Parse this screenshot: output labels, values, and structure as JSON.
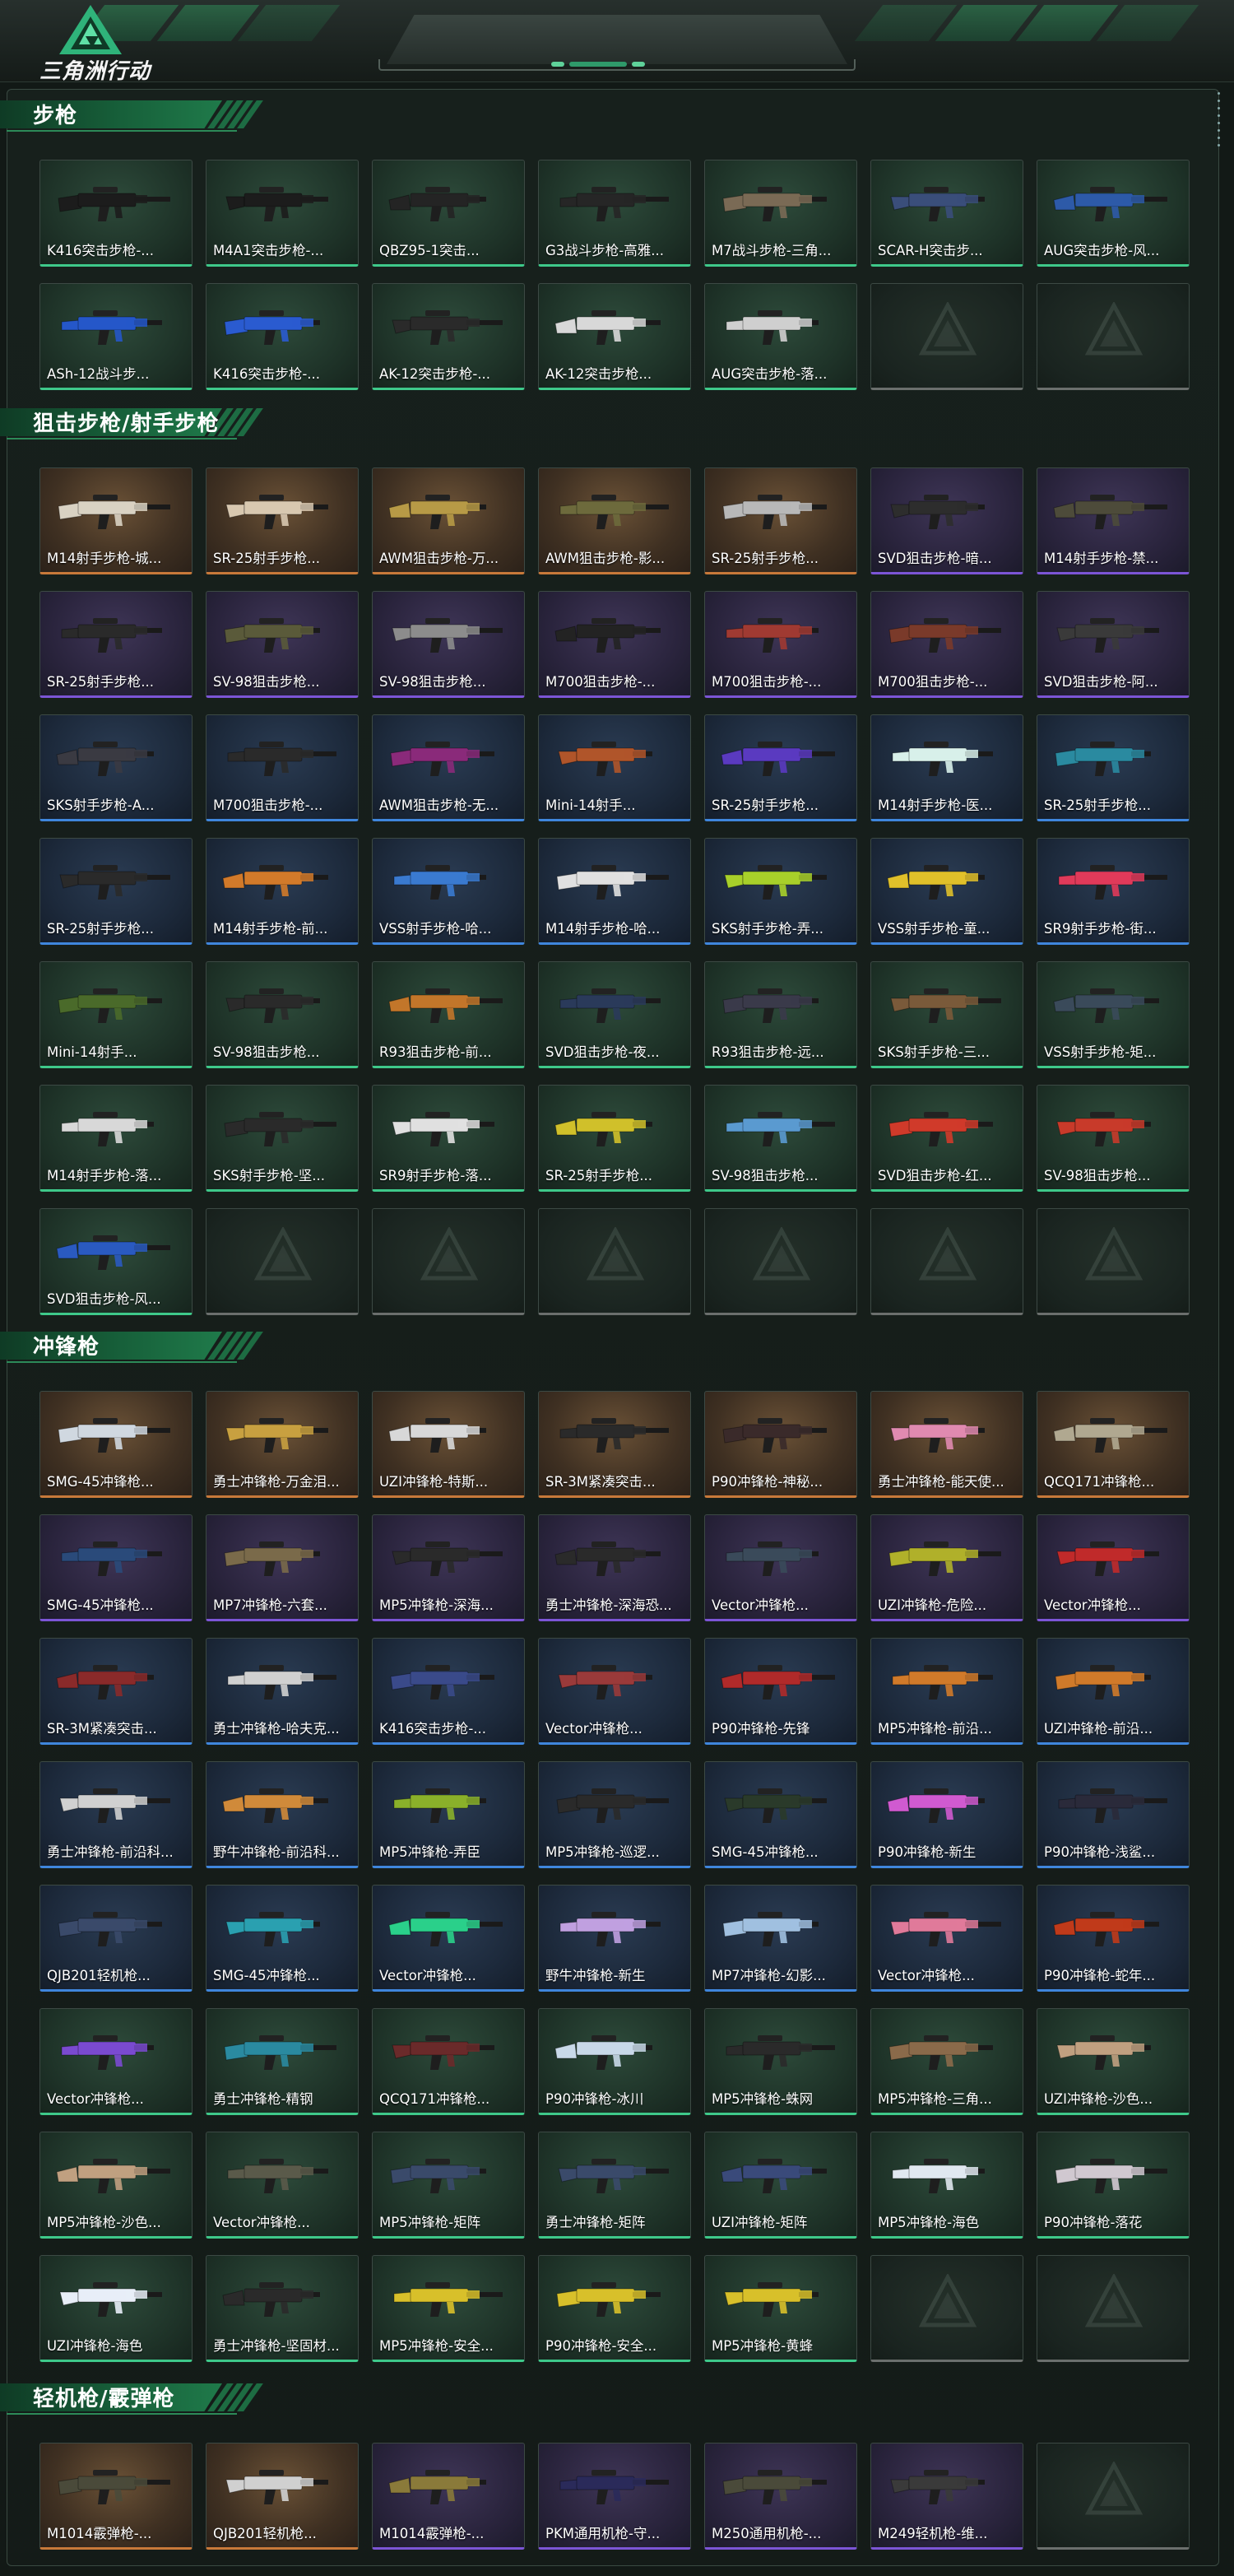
{
  "app": {
    "logo_text": "三角洲行动"
  },
  "colors": {
    "rarity_gold": "#c8793a",
    "rarity_purple": "#7c55d6",
    "rarity_blue": "#3f86dd",
    "rarity_green": "#3ec98a",
    "accent": "#1f7a4a"
  },
  "sections": [
    {
      "title": "步枪",
      "items": [
        {
          "label": "K416突击步枪-...",
          "rarity": "green",
          "color": "#1c1c1c"
        },
        {
          "label": "M4A1突击步枪-...",
          "rarity": "green",
          "color": "#1c1c1c"
        },
        {
          "label": "QBZ95-1突击...",
          "rarity": "green",
          "color": "#242424"
        },
        {
          "label": "G3战斗步枪-高雅...",
          "rarity": "green",
          "color": "#262626"
        },
        {
          "label": "M7战斗步枪-三角...",
          "rarity": "green",
          "color": "#7a6a55"
        },
        {
          "label": "SCAR-H突击步...",
          "rarity": "green",
          "color": "#3a4e7a"
        },
        {
          "label": "AUG突击步枪-风...",
          "rarity": "green",
          "color": "#2d5aa8"
        },
        {
          "label": "ASh-12战斗步...",
          "rarity": "green",
          "color": "#2557c9"
        },
        {
          "label": "K416突击步枪-...",
          "rarity": "green",
          "color": "#2a5bd0"
        },
        {
          "label": "AK-12突击步枪-...",
          "rarity": "green",
          "color": "#2a2a2a"
        },
        {
          "label": "AK-12突击步枪...",
          "rarity": "green",
          "color": "#d8d8d8"
        },
        {
          "label": "AUG突击步枪-落...",
          "rarity": "green",
          "color": "#cfcfcf"
        },
        {
          "label": "",
          "rarity": "empty"
        },
        {
          "label": "",
          "rarity": "empty"
        }
      ]
    },
    {
      "title": "狙击步枪/射手步枪",
      "items": [
        {
          "label": "M14射手步枪-城...",
          "rarity": "gold",
          "color": "#d9d2c3"
        },
        {
          "label": "SR-25射手步枪...",
          "rarity": "gold",
          "color": "#d8c8b0"
        },
        {
          "label": "AWM狙击步枪-万...",
          "rarity": "gold",
          "color": "#b79a46"
        },
        {
          "label": "AWM狙击步枪-影...",
          "rarity": "gold",
          "color": "#6d6a3c"
        },
        {
          "label": "SR-25射手步枪...",
          "rarity": "gold",
          "color": "#b8b8b8"
        },
        {
          "label": "SVD狙击步枪-暗...",
          "rarity": "purple",
          "color": "#2d2d2d"
        },
        {
          "label": "M14射手步枪-禁...",
          "rarity": "purple",
          "color": "#4d4b3a"
        },
        {
          "label": "SR-25射手步枪...",
          "rarity": "purple",
          "color": "#2a2a2a"
        },
        {
          "label": "SV-98狙击步枪...",
          "rarity": "purple",
          "color": "#5a5a3a"
        },
        {
          "label": "SV-98狙击步枪...",
          "rarity": "purple",
          "color": "#8c8c8c"
        },
        {
          "label": "M700狙击步枪-...",
          "rarity": "purple",
          "color": "#232323"
        },
        {
          "label": "M700狙击步枪-...",
          "rarity": "purple",
          "color": "#a03a32"
        },
        {
          "label": "M700狙击步枪-...",
          "rarity": "purple",
          "color": "#7a3a2a"
        },
        {
          "label": "SVD狙击步枪-阿...",
          "rarity": "purple",
          "color": "#3a3a3a"
        },
        {
          "label": "SKS射手步枪-A...",
          "rarity": "blue",
          "color": "#3a3a42"
        },
        {
          "label": "M700狙击步枪-...",
          "rarity": "blue",
          "color": "#2a2a2a"
        },
        {
          "label": "AWM狙击步枪-无...",
          "rarity": "blue",
          "color": "#8a2a7a"
        },
        {
          "label": "Mini-14射手...",
          "rarity": "blue",
          "color": "#b0552a"
        },
        {
          "label": "SR-25射手步枪...",
          "rarity": "blue",
          "color": "#5a3ac0"
        },
        {
          "label": "M14射手步枪-医...",
          "rarity": "blue",
          "color": "#d8f0ea"
        },
        {
          "label": "SR-25射手步枪...",
          "rarity": "blue",
          "color": "#2a8aa0"
        },
        {
          "label": "SR-25射手步枪...",
          "rarity": "blue",
          "color": "#2a2a2a"
        },
        {
          "label": "M14射手步枪-前...",
          "rarity": "blue",
          "color": "#d27a2a"
        },
        {
          "label": "VSS射手步枪-哈...",
          "rarity": "blue",
          "color": "#3a7ad0"
        },
        {
          "label": "M14射手步枪-哈...",
          "rarity": "blue",
          "color": "#e0e0e0"
        },
        {
          "label": "SKS射手步枪-弄...",
          "rarity": "blue",
          "color": "#a8d02a"
        },
        {
          "label": "VSS射手步枪-童...",
          "rarity": "blue",
          "color": "#e0c02a"
        },
        {
          "label": "SR9射手步枪-街...",
          "rarity": "blue",
          "color": "#e03a5a"
        },
        {
          "label": "Mini-14射手...",
          "rarity": "green",
          "color": "#4a6a2a"
        },
        {
          "label": "SV-98狙击步枪...",
          "rarity": "green",
          "color": "#2a2a2a"
        },
        {
          "label": "R93狙击步枪-前...",
          "rarity": "green",
          "color": "#c2762a"
        },
        {
          "label": "SVD狙击步枪-夜...",
          "rarity": "green",
          "color": "#2a3a5a"
        },
        {
          "label": "R93狙击步枪-远...",
          "rarity": "green",
          "color": "#3a3a4a"
        },
        {
          "label": "SKS射手步枪-三...",
          "rarity": "green",
          "color": "#7a5a3a"
        },
        {
          "label": "VSS射手步枪-矩...",
          "rarity": "green",
          "color": "#3a4a5a"
        },
        {
          "label": "M14射手步枪-落...",
          "rarity": "green",
          "color": "#d8d8d8"
        },
        {
          "label": "SKS射手步枪-坚...",
          "rarity": "green",
          "color": "#2a2a2a"
        },
        {
          "label": "SR9射手步枪-落...",
          "rarity": "green",
          "color": "#e0e0e0"
        },
        {
          "label": "SR-25射手步枪...",
          "rarity": "green",
          "color": "#d0c02a"
        },
        {
          "label": "SV-98狙击步枪...",
          "rarity": "green",
          "color": "#5a9ad0"
        },
        {
          "label": "SVD狙击步枪-红...",
          "rarity": "green",
          "color": "#d03a2a"
        },
        {
          "label": "SV-98狙击步枪...",
          "rarity": "green",
          "color": "#c83a2a"
        },
        {
          "label": "SVD狙击步枪-风...",
          "rarity": "green",
          "color": "#2a5ac0"
        },
        {
          "label": "",
          "rarity": "empty"
        },
        {
          "label": "",
          "rarity": "empty"
        },
        {
          "label": "",
          "rarity": "empty"
        },
        {
          "label": "",
          "rarity": "empty"
        },
        {
          "label": "",
          "rarity": "empty"
        },
        {
          "label": "",
          "rarity": "empty"
        }
      ]
    },
    {
      "title": "冲锋枪",
      "items": [
        {
          "label": "SMG-45冲锋枪...",
          "rarity": "gold",
          "color": "#d0d8e0"
        },
        {
          "label": "勇士冲锋枪-万金泪...",
          "rarity": "gold",
          "color": "#c8a040"
        },
        {
          "label": "UZI冲锋枪-特斯...",
          "rarity": "gold",
          "color": "#d8d8d8"
        },
        {
          "label": "SR-3M紧凑突击...",
          "rarity": "gold",
          "color": "#2a2a2a"
        },
        {
          "label": "P90冲锋枪-神秘...",
          "rarity": "gold",
          "color": "#3a2a2a"
        },
        {
          "label": "勇士冲锋枪-能天使...",
          "rarity": "gold",
          "color": "#e08ab0"
        },
        {
          "label": "QCQ171冲锋枪...",
          "rarity": "gold",
          "color": "#b0a890"
        },
        {
          "label": "SMG-45冲锋枪...",
          "rarity": "purple",
          "color": "#2a4a7a"
        },
        {
          "label": "MP7冲锋枪-六套...",
          "rarity": "purple",
          "color": "#7a6a4a"
        },
        {
          "label": "MP5冲锋枪-深海...",
          "rarity": "purple",
          "color": "#2a2a2a"
        },
        {
          "label": "勇士冲锋枪-深海恐...",
          "rarity": "purple",
          "color": "#2a2a2a"
        },
        {
          "label": "Vector冲锋枪...",
          "rarity": "purple",
          "color": "#3a4a5a"
        },
        {
          "label": "UZI冲锋枪-危险...",
          "rarity": "purple",
          "color": "#b0b02a"
        },
        {
          "label": "Vector冲锋枪...",
          "rarity": "purple",
          "color": "#c02a2a"
        },
        {
          "label": "SR-3M紧凑突击...",
          "rarity": "blue",
          "color": "#8a2a2a"
        },
        {
          "label": "勇士冲锋枪-哈夫克...",
          "rarity": "blue",
          "color": "#d0d0d0"
        },
        {
          "label": "K416突击步枪-...",
          "rarity": "blue",
          "color": "#3a4a8a"
        },
        {
          "label": "Vector冲锋枪...",
          "rarity": "blue",
          "color": "#9a3a3a"
        },
        {
          "label": "P90冲锋枪-先锋",
          "rarity": "blue",
          "color": "#b02a2a"
        },
        {
          "label": "MP5冲锋枪-前沿...",
          "rarity": "blue",
          "color": "#d07a2a"
        },
        {
          "label": "UZI冲锋枪-前沿...",
          "rarity": "blue",
          "color": "#d07a2a"
        },
        {
          "label": "勇士冲锋枪-前沿科...",
          "rarity": "blue",
          "color": "#d0d0d0"
        },
        {
          "label": "野牛冲锋枪-前沿科...",
          "rarity": "blue",
          "color": "#d08a3a"
        },
        {
          "label": "MP5冲锋枪-弄臣",
          "rarity": "blue",
          "color": "#8ab02a"
        },
        {
          "label": "MP5冲锋枪-巡逻...",
          "rarity": "blue",
          "color": "#2a2a2a"
        },
        {
          "label": "SMG-45冲锋枪...",
          "rarity": "blue",
          "color": "#2a3a2a"
        },
        {
          "label": "P90冲锋枪-新生",
          "rarity": "blue",
          "color": "#d05ad0"
        },
        {
          "label": "P90冲锋枪-浅鲨...",
          "rarity": "blue",
          "color": "#2a2a3a"
        },
        {
          "label": "QJB201轻机枪...",
          "rarity": "blue",
          "color": "#3a4a6a"
        },
        {
          "label": "SMG-45冲锋枪...",
          "rarity": "blue",
          "color": "#2aa0b0"
        },
        {
          "label": "Vector冲锋枪...",
          "rarity": "blue",
          "color": "#2ad08a"
        },
        {
          "label": "野牛冲锋枪-新生",
          "rarity": "blue",
          "color": "#c0a0e0"
        },
        {
          "label": "MP7冲锋枪-幻影...",
          "rarity": "blue",
          "color": "#a0c0e0"
        },
        {
          "label": "Vector冲锋枪...",
          "rarity": "blue",
          "color": "#e07a9a"
        },
        {
          "label": "P90冲锋枪-蛇年...",
          "rarity": "blue",
          "color": "#c03a1a"
        },
        {
          "label": "Vector冲锋枪...",
          "rarity": "green",
          "color": "#7a4ad0"
        },
        {
          "label": "勇士冲锋枪-精钢",
          "rarity": "green",
          "color": "#2a8aa0"
        },
        {
          "label": "QCQ171冲锋枪...",
          "rarity": "green",
          "color": "#6a2a2a"
        },
        {
          "label": "P90冲锋枪-冰川",
          "rarity": "green",
          "color": "#c8d8e8"
        },
        {
          "label": "MP5冲锋枪-蛛网",
          "rarity": "green",
          "color": "#2a2a2a"
        },
        {
          "label": "MP5冲锋枪-三角...",
          "rarity": "green",
          "color": "#8a6a4a"
        },
        {
          "label": "UZI冲锋枪-沙色...",
          "rarity": "green",
          "color": "#c0a080"
        },
        {
          "label": "MP5冲锋枪-沙色...",
          "rarity": "green",
          "color": "#c0a080"
        },
        {
          "label": "Vector冲锋枪...",
          "rarity": "green",
          "color": "#5a5a4a"
        },
        {
          "label": "MP5冲锋枪-矩阵",
          "rarity": "green",
          "color": "#3a4a6a"
        },
        {
          "label": "勇士冲锋枪-矩阵",
          "rarity": "green",
          "color": "#3a4a6a"
        },
        {
          "label": "UZI冲锋枪-矩阵",
          "rarity": "green",
          "color": "#3a4a7a"
        },
        {
          "label": "MP5冲锋枪-海色",
          "rarity": "green",
          "color": "#e0e8f0"
        },
        {
          "label": "P90冲锋枪-落花",
          "rarity": "green",
          "color": "#d0c8d0"
        },
        {
          "label": "UZI冲锋枪-海色",
          "rarity": "green",
          "color": "#e8eef8"
        },
        {
          "label": "勇士冲锋枪-坚固材...",
          "rarity": "green",
          "color": "#2a2a2a"
        },
        {
          "label": "MP5冲锋枪-安全...",
          "rarity": "green",
          "color": "#d8c02a"
        },
        {
          "label": "P90冲锋枪-安全...",
          "rarity": "green",
          "color": "#d8c02a"
        },
        {
          "label": "MP5冲锋枪-黄蜂",
          "rarity": "green",
          "color": "#d8c02a"
        },
        {
          "label": "",
          "rarity": "empty"
        },
        {
          "label": "",
          "rarity": "empty"
        }
      ]
    },
    {
      "title": "轻机枪/霰弹枪",
      "items": [
        {
          "label": "M1014霰弹枪-...",
          "rarity": "gold",
          "color": "#4a4a3a"
        },
        {
          "label": "QJB201轻机枪...",
          "rarity": "gold",
          "color": "#d0d0d0"
        },
        {
          "label": "M1014霰弹枪-...",
          "rarity": "purple",
          "color": "#8a7a3a"
        },
        {
          "label": "PKM通用机枪-守...",
          "rarity": "purple",
          "color": "#2a2a5a"
        },
        {
          "label": "M250通用机枪-...",
          "rarity": "purple",
          "color": "#4a4a3a"
        },
        {
          "label": "M249轻机枪-维...",
          "rarity": "purple",
          "color": "#3a3a3a"
        },
        {
          "label": "",
          "rarity": "empty"
        }
      ]
    }
  ]
}
